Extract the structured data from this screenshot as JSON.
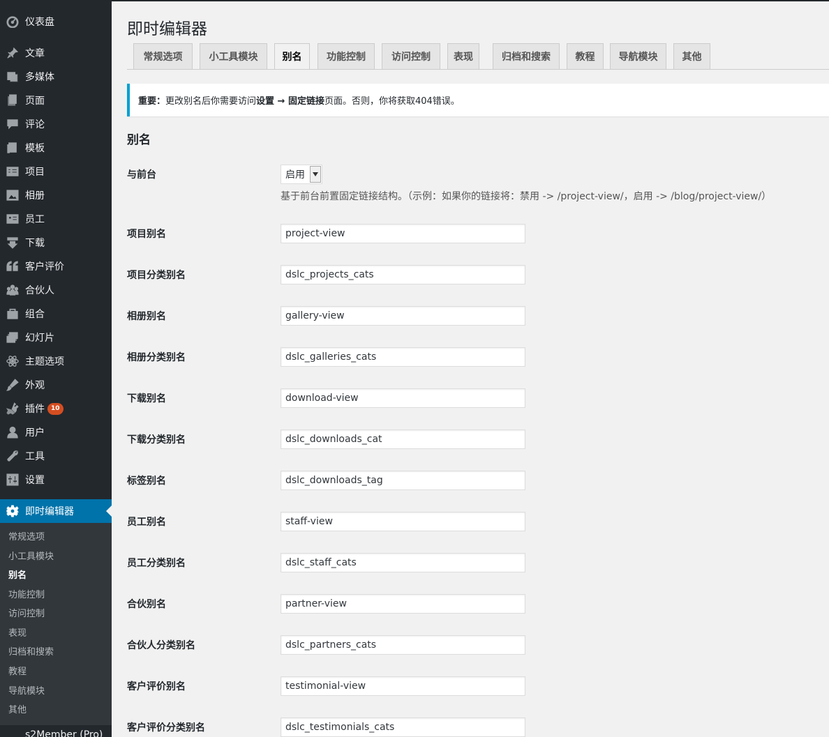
{
  "sidebar": {
    "items": [
      {
        "label": "仪表盘",
        "icon": "dashboard-icon"
      },
      {
        "label": "文章",
        "icon": "pin-icon"
      },
      {
        "label": "多媒体",
        "icon": "media-icon"
      },
      {
        "label": "页面",
        "icon": "page-icon"
      },
      {
        "label": "评论",
        "icon": "comment-icon"
      },
      {
        "label": "模板",
        "icon": "template-icon"
      },
      {
        "label": "项目",
        "icon": "projects-icon"
      },
      {
        "label": "相册",
        "icon": "gallery-icon"
      },
      {
        "label": "员工",
        "icon": "staff-icon"
      },
      {
        "label": "下载",
        "icon": "download-icon"
      },
      {
        "label": "客户评价",
        "icon": "quote-icon"
      },
      {
        "label": "合伙人",
        "icon": "groups-icon"
      },
      {
        "label": "组合",
        "icon": "portfolio-icon"
      },
      {
        "label": "幻灯片",
        "icon": "slides-icon"
      },
      {
        "label": "主题选项",
        "icon": "atom-icon"
      },
      {
        "label": "外观",
        "icon": "brush-icon"
      },
      {
        "label": "插件",
        "icon": "plugin-icon",
        "badge": "10"
      },
      {
        "label": "用户",
        "icon": "user-icon"
      },
      {
        "label": "工具",
        "icon": "wrench-icon"
      },
      {
        "label": "设置",
        "icon": "settings-icon"
      }
    ],
    "current": {
      "label": "即时编辑器",
      "icon": "gear-icon"
    },
    "submenu": [
      "常规选项",
      "小工具模块",
      "别名",
      "功能控制",
      "访问控制",
      "表现",
      "归档和搜索",
      "教程",
      "导航模块",
      "其他"
    ],
    "submenu_active": "别名",
    "cut_item": "s2Member (Pro)"
  },
  "page": {
    "title": "即时编辑器",
    "tabs": [
      "常规选项",
      "小工具模块",
      "别名",
      "功能控制",
      "访问控制",
      "表现",
      "归档和搜索",
      "教程",
      "导航模块",
      "其他"
    ],
    "active_tab": "别名"
  },
  "notice": {
    "prefix": "重要：",
    "text1": "更改别名后你需要访问",
    "bold1": "设置 → 固定链接",
    "text2": "页面。否则，你将获取404错误。"
  },
  "section": {
    "title": "别名"
  },
  "frontend": {
    "label": "与前台",
    "value": "启用",
    "description": "基于前台前置固定链接结构。（示例：如果你的链接将：禁用 -> /project-view/，启用 -> /blog/project-view/）"
  },
  "fields": [
    {
      "label": "项目别名",
      "value": "project-view"
    },
    {
      "label": "项目分类别名",
      "value": "dslc_projects_cats"
    },
    {
      "label": "相册别名",
      "value": "gallery-view"
    },
    {
      "label": "相册分类别名",
      "value": "dslc_galleries_cats"
    },
    {
      "label": "下载别名",
      "value": "download-view"
    },
    {
      "label": "下载分类别名",
      "value": "dslc_downloads_cat"
    },
    {
      "label": "标签别名",
      "value": "dslc_downloads_tag"
    },
    {
      "label": "员工别名",
      "value": "staff-view"
    },
    {
      "label": "员工分类别名",
      "value": "dslc_staff_cats"
    },
    {
      "label": "合伙别名",
      "value": "partner-view"
    },
    {
      "label": "合伙人分类别名",
      "value": "dslc_partners_cats"
    },
    {
      "label": "客户评价别名",
      "value": "testimonial-view"
    },
    {
      "label": "客户评价分类别名",
      "value": "dslc_testimonials_cats"
    }
  ],
  "colors": {
    "sidebar_bg": "#23282d",
    "submenu_bg": "#32373c",
    "accent": "#0073aa",
    "notice_border": "#00a0d2",
    "badge": "#d54e21"
  }
}
